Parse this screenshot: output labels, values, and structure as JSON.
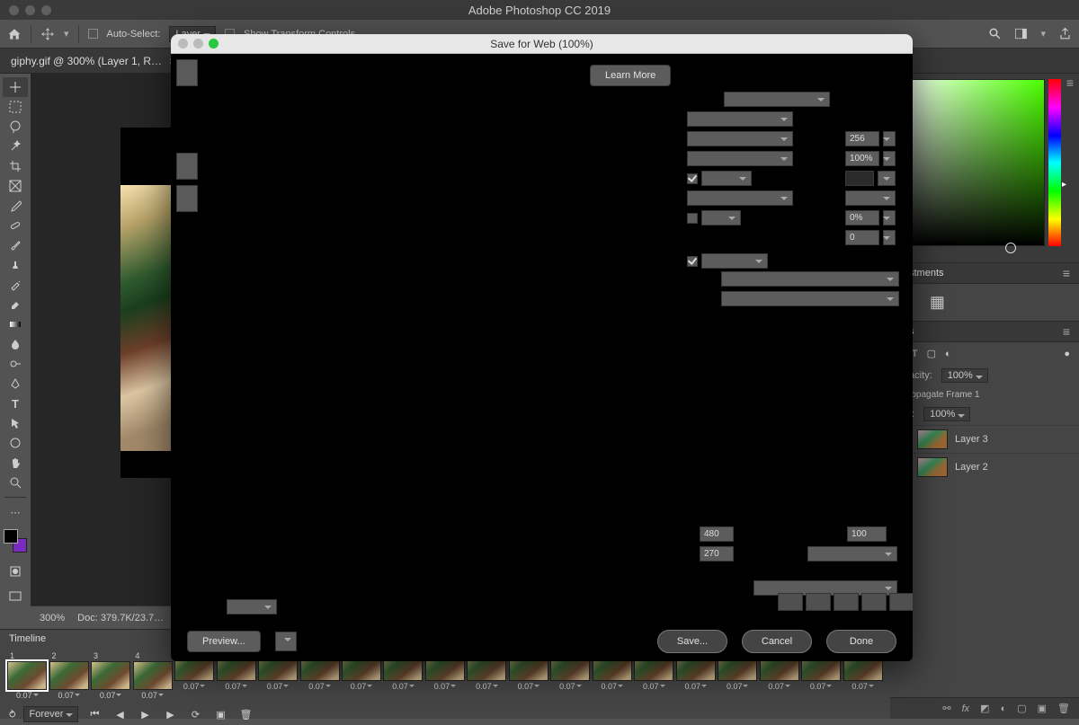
{
  "app_title": "Adobe Photoshop CC 2019",
  "options": {
    "auto_select": "Auto-Select:",
    "layer_dd": "Layer",
    "transform": "Show Transform Controls"
  },
  "doc_tab": "giphy.gif @ 300% (Layer 1, R…",
  "status": {
    "zoom": "300%",
    "doc": "Doc: 379.7K/23.7…"
  },
  "dialog": {
    "title": "Save for Web (100%)",
    "learn_more": "Learn More",
    "vals": {
      "colors": "256",
      "dither": "100%",
      "lossy": "0%",
      "web_snap": "0"
    },
    "size": {
      "w": "480",
      "h": "270",
      "percent": "100"
    },
    "preview": "Preview...",
    "save": "Save...",
    "cancel": "Cancel",
    "done": "Done"
  },
  "adjustments_label": "…stments",
  "layers": {
    "opacity_label": "…acity:",
    "opacity": "100%",
    "propagate": "…ropagate Frame 1",
    "fill_label": "Fill:",
    "fill": "100%",
    "items": [
      "Layer 3",
      "Layer 2"
    ]
  },
  "timeline": {
    "label": "Timeline",
    "forever": "Forever",
    "delay": "0.07",
    "frame_nums": [
      "1",
      "2",
      "3",
      "4"
    ]
  }
}
